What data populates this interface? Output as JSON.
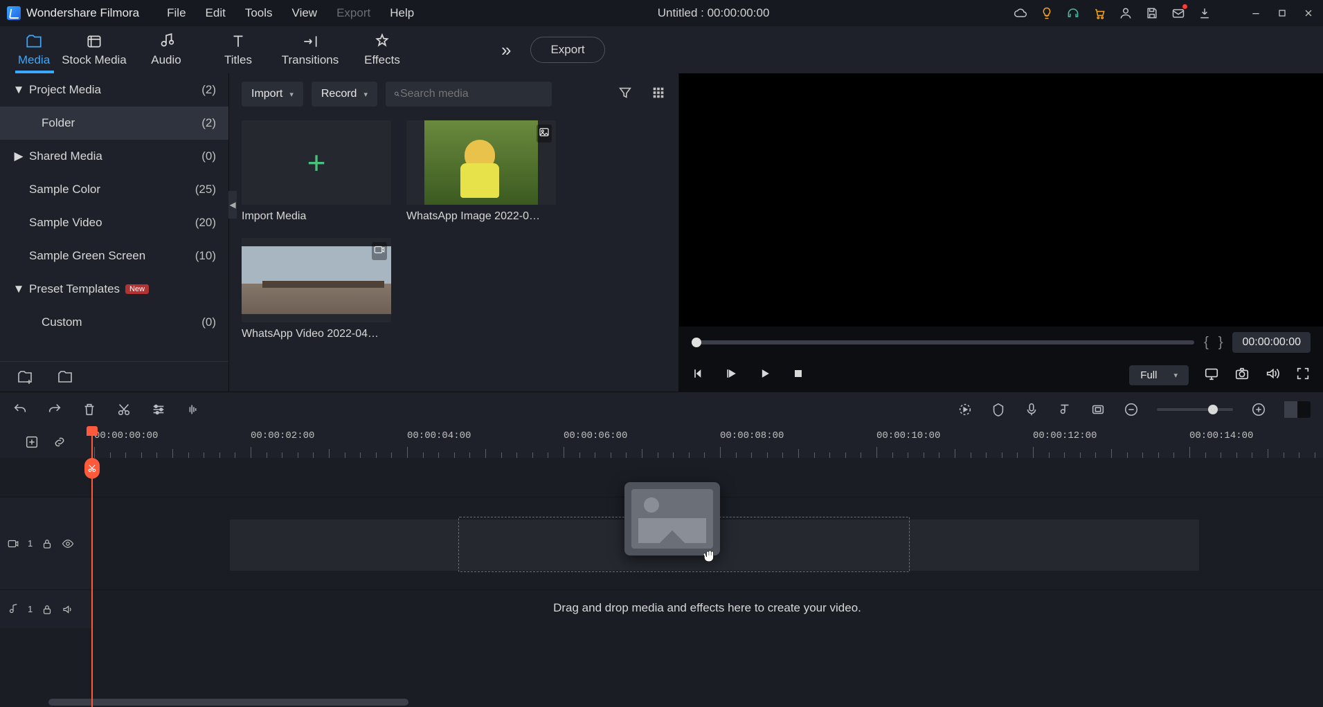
{
  "app": {
    "name": "Wondershare Filmora",
    "title": "Untitled : 00:00:00:00"
  },
  "menu": {
    "file": "File",
    "edit": "Edit",
    "tools": "Tools",
    "view": "View",
    "export": "Export",
    "help": "Help"
  },
  "ribbon": {
    "tabs": {
      "media": "Media",
      "stock": "Stock Media",
      "audio": "Audio",
      "titles": "Titles",
      "transitions": "Transitions",
      "effects": "Effects"
    },
    "export_btn": "Export"
  },
  "tree": {
    "project": {
      "label": "Project Media",
      "count": "(2)"
    },
    "folder": {
      "label": "Folder",
      "count": "(2)"
    },
    "shared": {
      "label": "Shared Media",
      "count": "(0)"
    },
    "color": {
      "label": "Sample Color",
      "count": "(25)"
    },
    "video": {
      "label": "Sample Video",
      "count": "(20)"
    },
    "green": {
      "label": "Sample Green Screen",
      "count": "(10)"
    },
    "preset": {
      "label": "Preset Templates",
      "badge": "New"
    },
    "custom": {
      "label": "Custom",
      "count": "(0)"
    }
  },
  "browser": {
    "import_btn": "Import",
    "record_btn": "Record",
    "search_placeholder": "Search media",
    "items": {
      "import_tile": "Import Media",
      "img1": "WhatsApp Image 2022-0…",
      "vid1": "WhatsApp Video 2022-04…"
    }
  },
  "preview": {
    "mark_in": "{",
    "mark_out": "}",
    "timecode": "00:00:00:00",
    "quality": "Full"
  },
  "ruler": {
    "ticks": [
      "00:00:00:00",
      "00:00:02:00",
      "00:00:04:00",
      "00:00:06:00",
      "00:00:08:00",
      "00:00:10:00",
      "00:00:12:00",
      "00:00:14:00"
    ]
  },
  "tracks": {
    "video1": "1",
    "audio1": "1"
  },
  "timeline": {
    "hint": "Drag and drop media and effects here to create your video."
  }
}
